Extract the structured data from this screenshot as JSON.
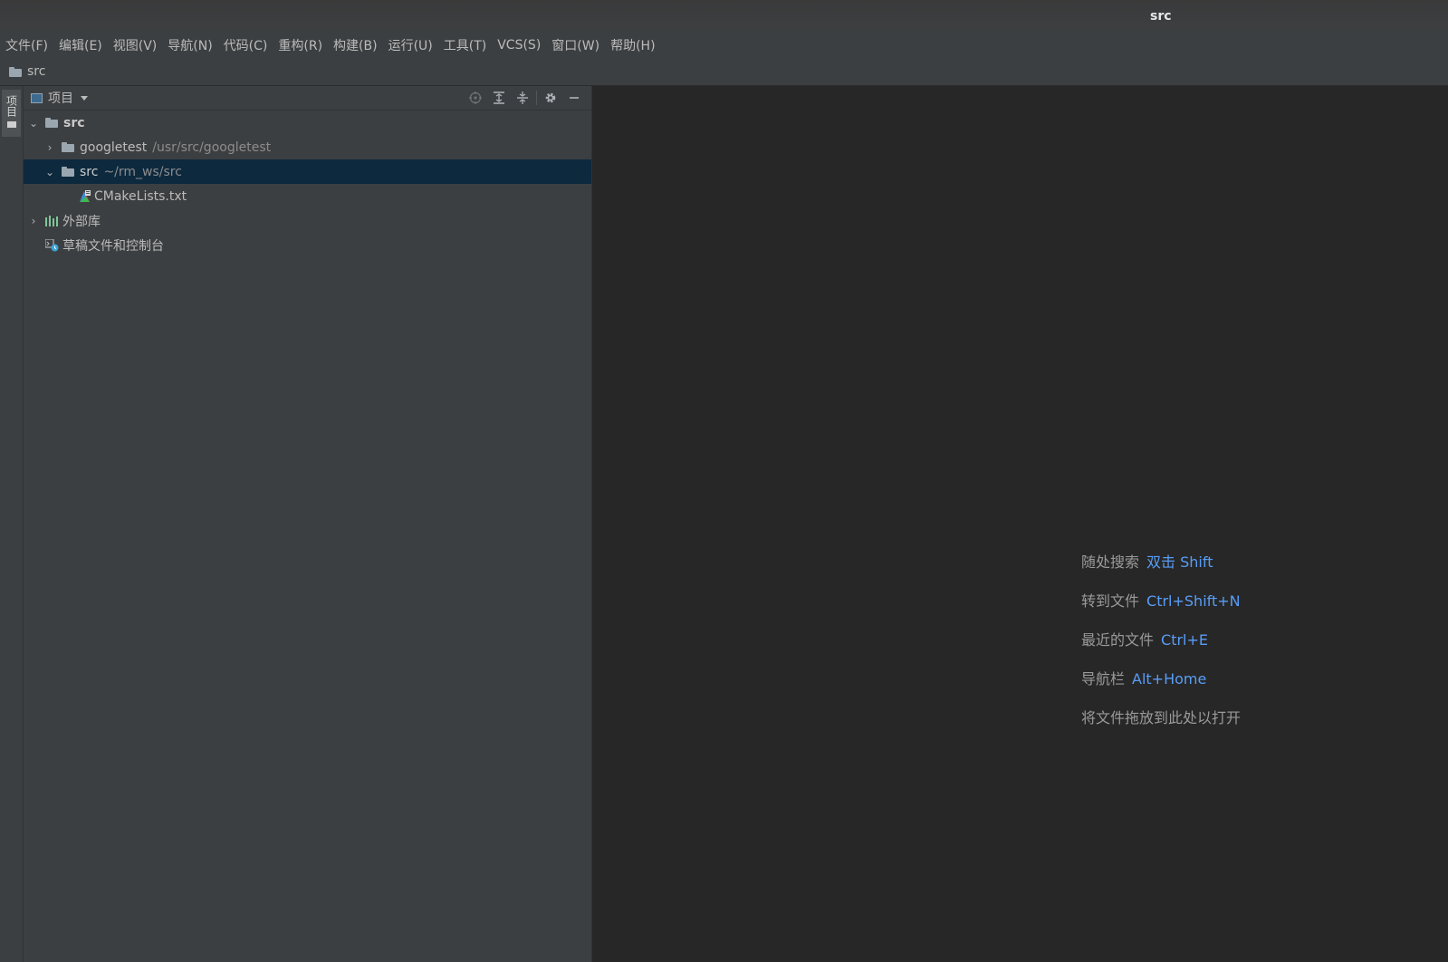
{
  "window": {
    "title": "src"
  },
  "menu": [
    {
      "label": "文件(F)"
    },
    {
      "label": "编辑(E)"
    },
    {
      "label": "视图(V)"
    },
    {
      "label": "导航(N)"
    },
    {
      "label": "代码(C)"
    },
    {
      "label": "重构(R)"
    },
    {
      "label": "构建(B)"
    },
    {
      "label": "运行(U)"
    },
    {
      "label": "工具(T)"
    },
    {
      "label": "VCS(S)"
    },
    {
      "label": "窗口(W)"
    },
    {
      "label": "帮助(H)"
    }
  ],
  "breadcrumb": {
    "label": "src"
  },
  "side_tab": {
    "label": "项目"
  },
  "project_panel": {
    "title": "项目",
    "tree": {
      "root": {
        "label": "src"
      },
      "googletest": {
        "label": "googletest",
        "path": "/usr/src/googletest"
      },
      "src": {
        "label": "src",
        "path": "~/rm_ws/src"
      },
      "cmakelists": {
        "label": "CMakeLists.txt"
      },
      "external": {
        "label": "外部库"
      },
      "scratches": {
        "label": "草稿文件和控制台"
      }
    }
  },
  "editor_hints": [
    {
      "text": "随处搜索",
      "key": "双击 Shift"
    },
    {
      "text": "转到文件",
      "key": "Ctrl+Shift+N"
    },
    {
      "text": "最近的文件",
      "key": "Ctrl+E"
    },
    {
      "text": "导航栏",
      "key": "Alt+Home"
    },
    {
      "text": "将文件拖放到此处以打开",
      "key": ""
    }
  ],
  "colors": {
    "background": "#2b2b2b",
    "panel": "#3c3f41",
    "selection": "#0d293e",
    "link": "#589df6"
  }
}
